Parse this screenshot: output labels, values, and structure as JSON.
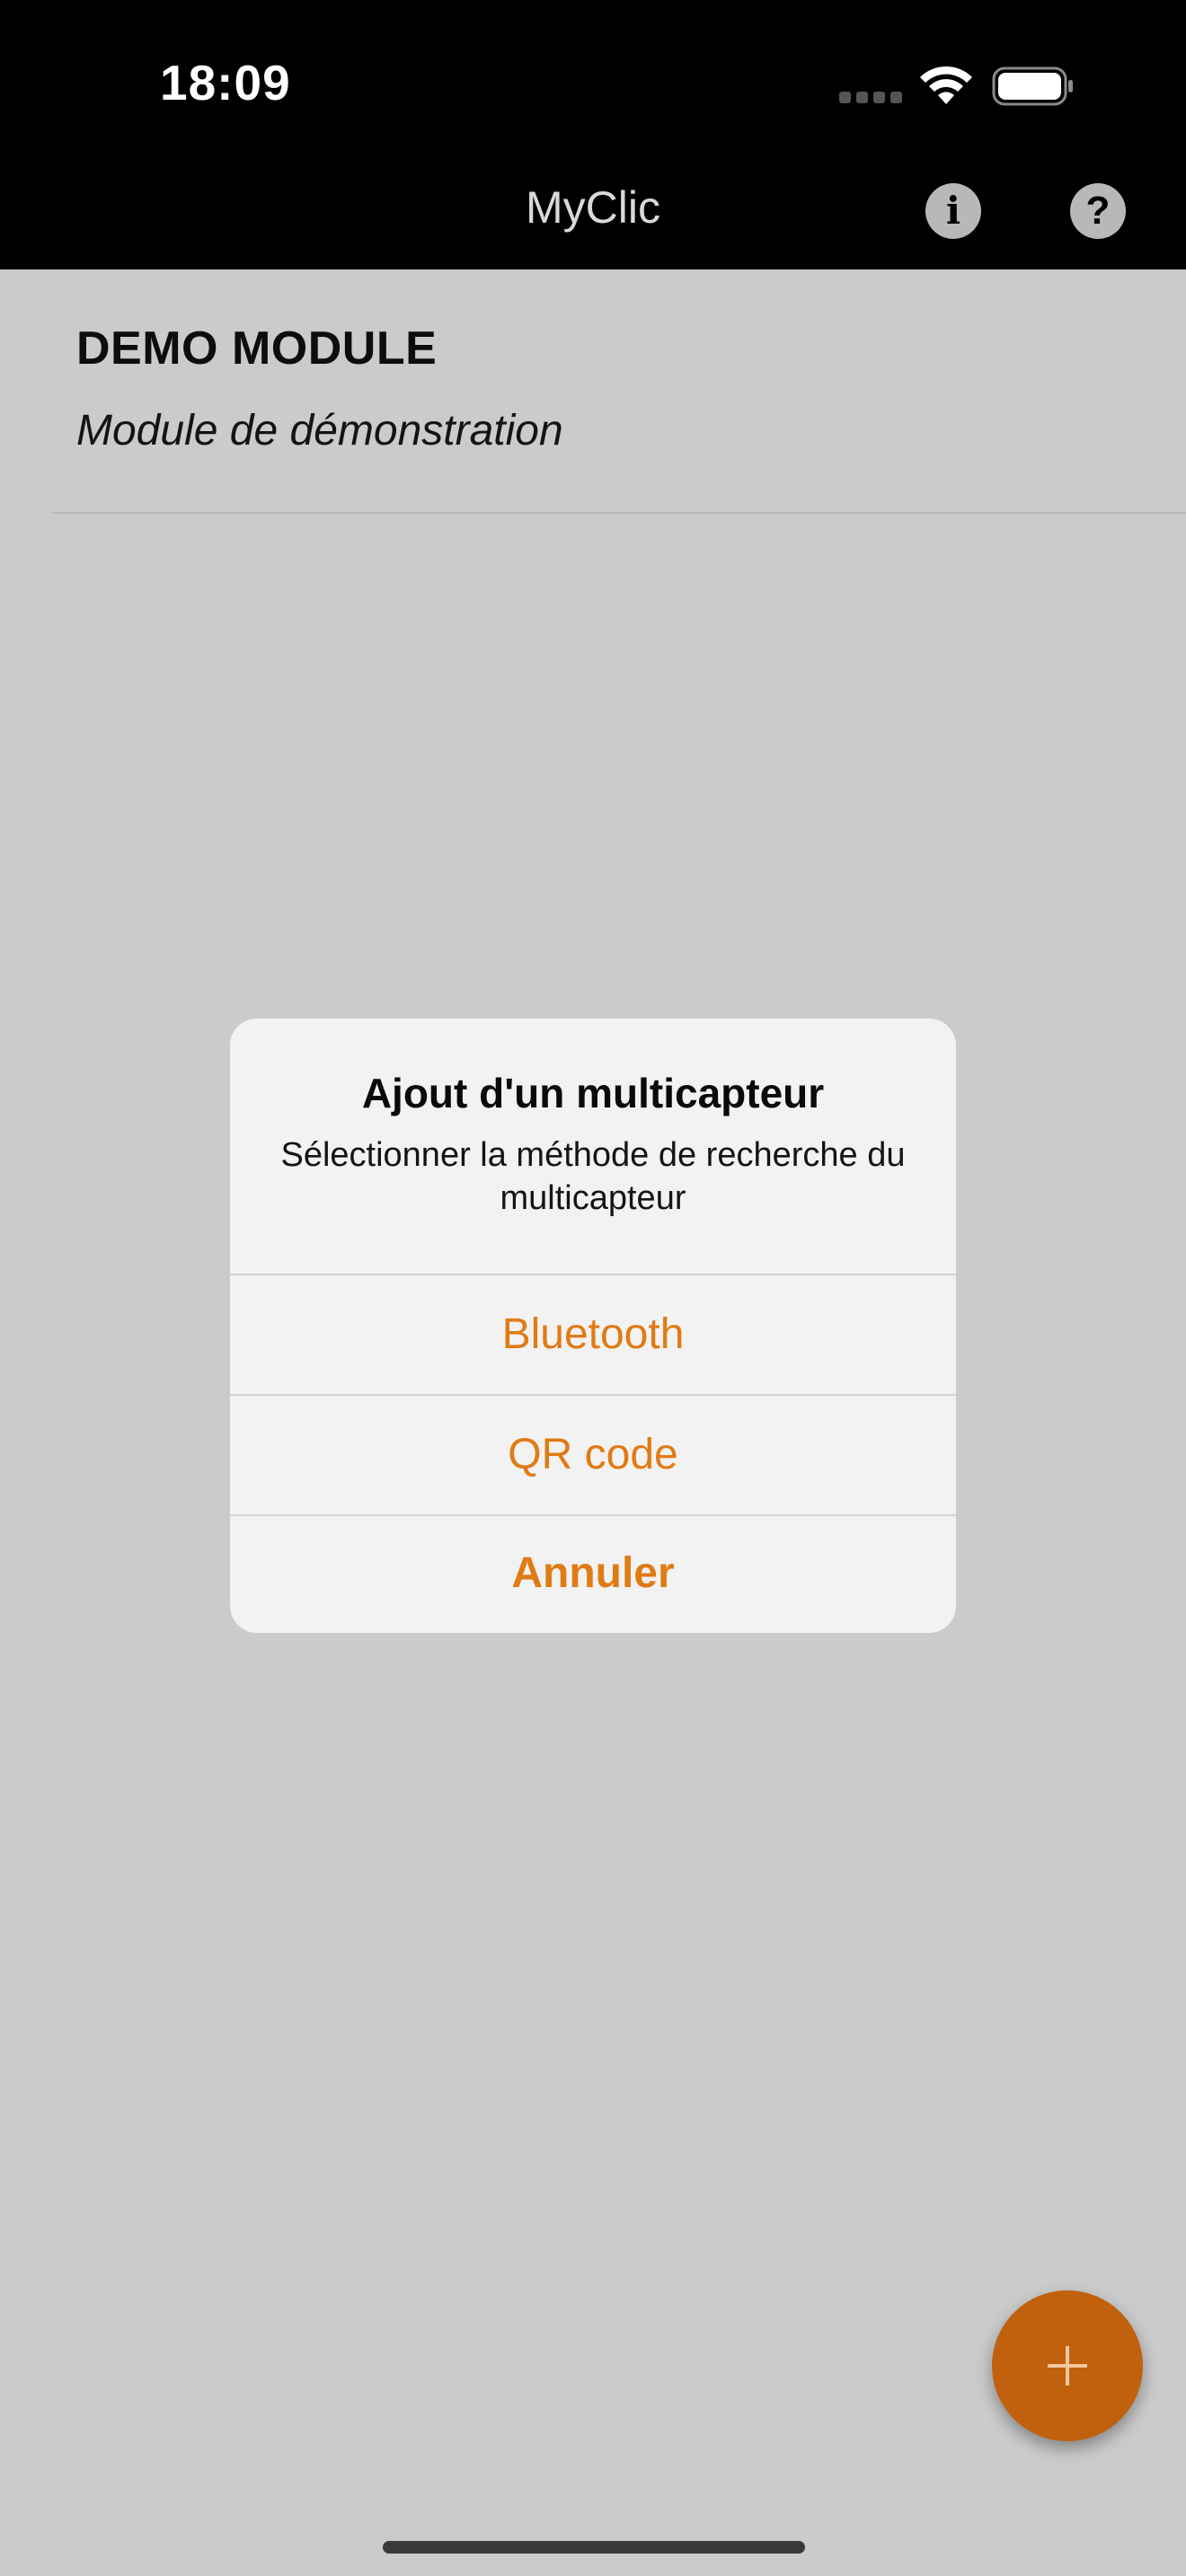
{
  "status_bar": {
    "time": "18:09",
    "icons": [
      "cellular-signal-icon",
      "wifi-icon",
      "battery-icon"
    ]
  },
  "nav": {
    "title": "MyClic",
    "info_icon": "info-icon",
    "help_icon": "help-icon",
    "info_glyph": "i",
    "help_glyph": "?"
  },
  "module": {
    "title": "DEMO MODULE",
    "subtitle": "Module de démonstration"
  },
  "alert": {
    "title": "Ajout d'un multicapteur",
    "message": "Sélectionner la méthode de recherche du multicapteur",
    "actions": [
      {
        "label": "Bluetooth"
      },
      {
        "label": "QR code"
      },
      {
        "label": "Annuler"
      }
    ]
  },
  "fab": {
    "icon": "plus-icon"
  },
  "colors": {
    "accent": "#e07b14",
    "fab": "#c1600d",
    "dim_background": "#cbcbcb",
    "nav_background": "#000000"
  }
}
